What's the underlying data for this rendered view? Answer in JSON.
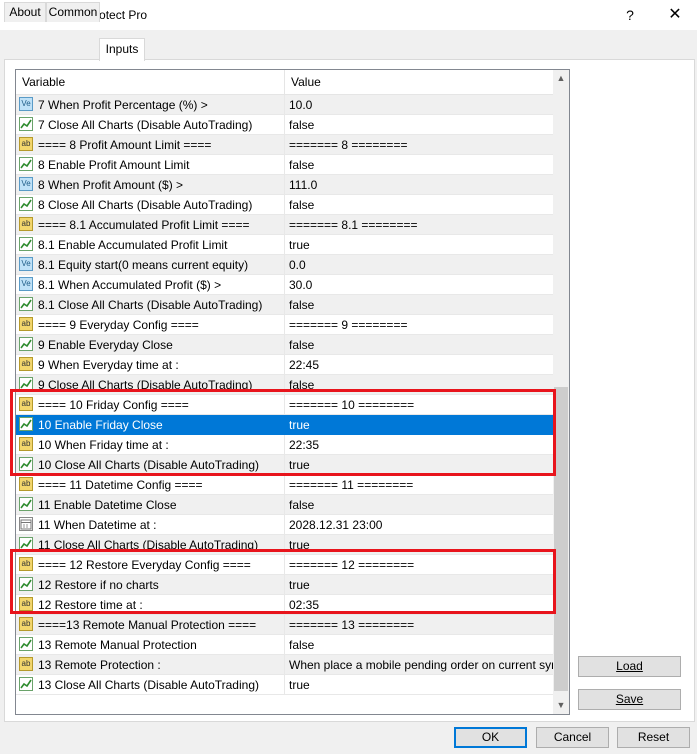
{
  "window": {
    "title": "Expert - Equity Protect Pro",
    "help_glyph": "?",
    "close_glyph": "✕"
  },
  "tabs": [
    {
      "label": "About"
    },
    {
      "label": "Common"
    },
    {
      "label": "Inputs"
    }
  ],
  "table": {
    "columns": {
      "variable": "Variable",
      "value": "Value"
    },
    "rows": [
      {
        "icon": "ve",
        "variable": "7 When Profit Percentage (%) >",
        "value": "10.0"
      },
      {
        "icon": "bool",
        "variable": "7 Close All Charts (Disable AutoTrading)",
        "value": "false"
      },
      {
        "icon": "ab",
        "variable": "==== 8 Profit Amount Limit ====",
        "value": "======= 8 ========"
      },
      {
        "icon": "bool",
        "variable": "8 Enable Profit Amount Limit",
        "value": "false"
      },
      {
        "icon": "ve",
        "variable": "8 When Profit Amount ($) >",
        "value": "111.0"
      },
      {
        "icon": "bool",
        "variable": "8 Close All Charts (Disable AutoTrading)",
        "value": "false"
      },
      {
        "icon": "ab",
        "variable": "==== 8.1 Accumulated Profit Limit ====",
        "value": "======= 8.1 ========"
      },
      {
        "icon": "bool",
        "variable": "8.1 Enable Accumulated Profit  Limit",
        "value": "true"
      },
      {
        "icon": "ve",
        "variable": "8.1 Equity start(0 means current equity)",
        "value": "0.0"
      },
      {
        "icon": "ve",
        "variable": "8.1 When Accumulated Profit ($) >",
        "value": "30.0"
      },
      {
        "icon": "bool",
        "variable": "8.1 Close All Charts (Disable AutoTrading)",
        "value": "false"
      },
      {
        "icon": "ab",
        "variable": "==== 9 Everyday Config ====",
        "value": "======= 9 ========"
      },
      {
        "icon": "bool",
        "variable": "9 Enable Everyday Close",
        "value": "false"
      },
      {
        "icon": "ab",
        "variable": "9 When Everyday time at :",
        "value": "22:45"
      },
      {
        "icon": "bool",
        "variable": "9 Close All Charts (Disable AutoTrading)",
        "value": "false"
      },
      {
        "icon": "ab",
        "variable": "==== 10 Friday Config ====",
        "value": "======= 10 ========"
      },
      {
        "icon": "bool",
        "variable": "10 Enable Friday Close",
        "value": "true",
        "selected": true
      },
      {
        "icon": "ab",
        "variable": "10 When Friday time at :",
        "value": "22:35"
      },
      {
        "icon": "bool",
        "variable": "10 Close All Charts (Disable AutoTrading)",
        "value": "true"
      },
      {
        "icon": "ab",
        "variable": "==== 11 Datetime Config ====",
        "value": "======= 11 ========"
      },
      {
        "icon": "bool",
        "variable": "11 Enable Datetime Close",
        "value": "false"
      },
      {
        "icon": "dt",
        "variable": "11 When Datetime at :",
        "value": "2028.12.31 23:00"
      },
      {
        "icon": "bool",
        "variable": "11 Close All Charts (Disable AutoTrading)",
        "value": "true"
      },
      {
        "icon": "ab",
        "variable": "==== 12 Restore Everyday Config ====",
        "value": "======= 12 ========"
      },
      {
        "icon": "bool",
        "variable": "12 Restore if no charts",
        "value": "true"
      },
      {
        "icon": "ab",
        "variable": "12 Restore time at :",
        "value": "02:35"
      },
      {
        "icon": "ab",
        "variable": "====13 Remote Manual Protection ====",
        "value": "======= 13 ========"
      },
      {
        "icon": "bool",
        "variable": "13 Remote Manual Protection",
        "value": "false"
      },
      {
        "icon": "ab",
        "variable": "13 Remote Protection :",
        "value": "When place a mobile pending order on current symbol"
      },
      {
        "icon": "bool",
        "variable": "13 Close All Charts (Disable AutoTrading)",
        "value": "true"
      }
    ]
  },
  "side_buttons": {
    "load": "Load",
    "save": "Save"
  },
  "footer_buttons": {
    "ok": "OK",
    "cancel": "Cancel",
    "reset": "Reset"
  },
  "colors": {
    "selection": "#0078d7",
    "highlight_box": "#e8141c"
  }
}
